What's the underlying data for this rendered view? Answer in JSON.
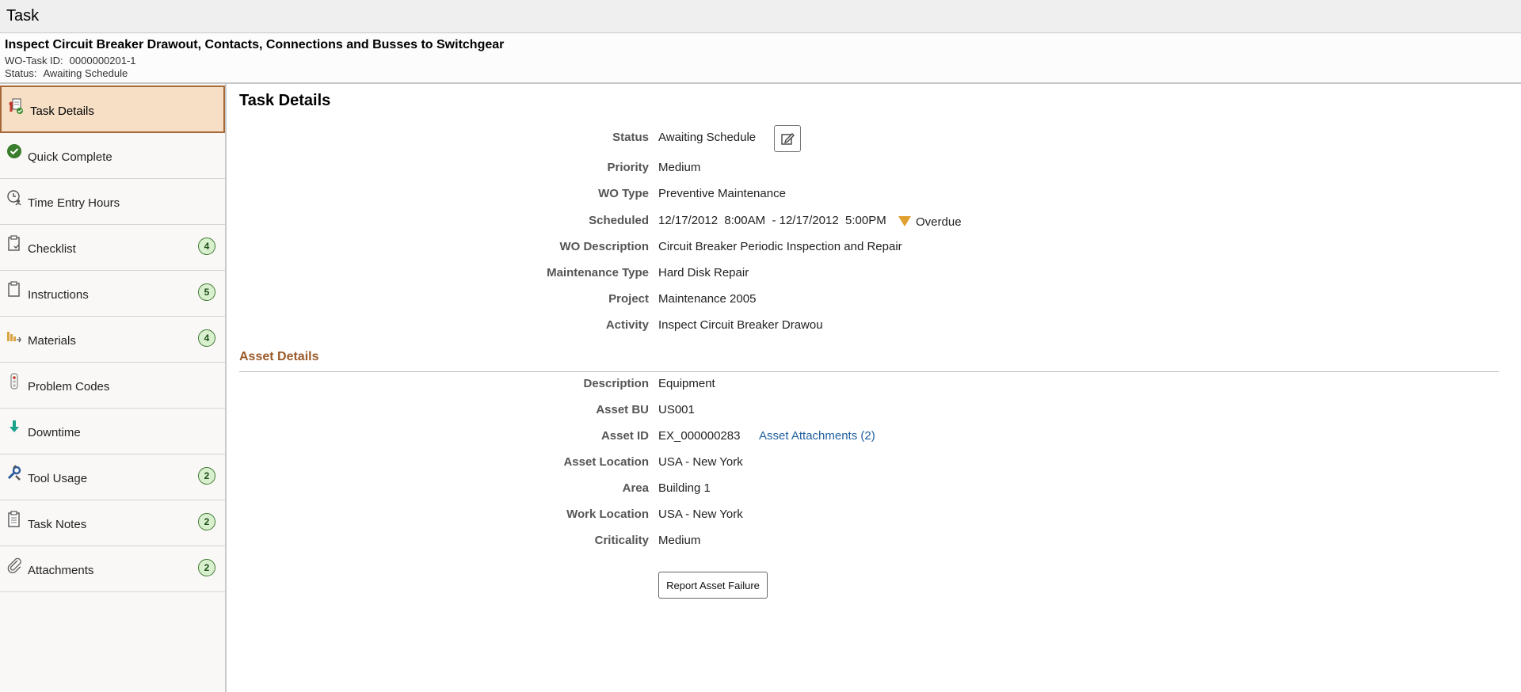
{
  "page": {
    "title": "Task"
  },
  "header": {
    "task_name": "Inspect Circuit Breaker Drawout, Contacts, Connections and Busses to Switchgear",
    "wo_task_label": "WO-Task ID:",
    "wo_task_value": "0000000201-1",
    "status_label": "Status:",
    "status_value": "Awaiting Schedule"
  },
  "sidebar": {
    "items": [
      {
        "label": "Task Details",
        "icon": "task-details-icon",
        "active": true
      },
      {
        "label": "Quick Complete",
        "icon": "check-circle-icon"
      },
      {
        "label": "Time Entry Hours",
        "icon": "clock-person-icon"
      },
      {
        "label": "Checklist",
        "icon": "clipboard-check-icon",
        "count": "4"
      },
      {
        "label": "Instructions",
        "icon": "clipboard-icon",
        "count": "5"
      },
      {
        "label": "Materials",
        "icon": "materials-icon",
        "count": "4"
      },
      {
        "label": "Problem Codes",
        "icon": "traffic-light-icon"
      },
      {
        "label": "Downtime",
        "icon": "down-arrow-icon"
      },
      {
        "label": "Tool Usage",
        "icon": "wrench-icon",
        "count": "2"
      },
      {
        "label": "Task Notes",
        "icon": "notes-icon",
        "count": "2"
      },
      {
        "label": "Attachments",
        "icon": "paperclip-icon",
        "count": "2"
      }
    ]
  },
  "task_details": {
    "title": "Task Details",
    "fields": [
      {
        "label": "Status",
        "value": "Awaiting Schedule"
      },
      {
        "label": "Priority",
        "value": "Medium"
      },
      {
        "label": "WO Type",
        "value": "Preventive Maintenance"
      },
      {
        "label": "Scheduled",
        "value": "12/17/2012  8:00AM  - 12/17/2012  5:00PM"
      },
      {
        "label": "WO Description",
        "value": "Circuit Breaker Periodic Inspection and Repair"
      },
      {
        "label": "Maintenance Type",
        "value": "Hard Disk Repair"
      },
      {
        "label": "Project",
        "value": "Maintenance 2005"
      },
      {
        "label": "Activity",
        "value": "Inspect Circuit Breaker Drawou"
      }
    ],
    "overdue_label": "Overdue"
  },
  "asset_details": {
    "title": "Asset Details",
    "fields": [
      {
        "label": "Description",
        "value": "Equipment"
      },
      {
        "label": "Asset BU",
        "value": "US001"
      },
      {
        "label": "Asset ID",
        "value": "EX_000000283"
      },
      {
        "label": "Asset Location",
        "value": "USA - New York"
      },
      {
        "label": "Area",
        "value": "Building 1"
      },
      {
        "label": "Work Location",
        "value": "USA - New York"
      },
      {
        "label": "Criticality",
        "value": "Medium"
      }
    ],
    "attachments_link": "Asset Attachments (2)",
    "report_button": "Report Asset Failure"
  },
  "colors": {
    "accent": "#a66a3a",
    "active_bg": "#f6dfc5",
    "link": "#1f5f9f",
    "overdue": "#e0a030",
    "badge_bg": "#d9f0cf"
  }
}
